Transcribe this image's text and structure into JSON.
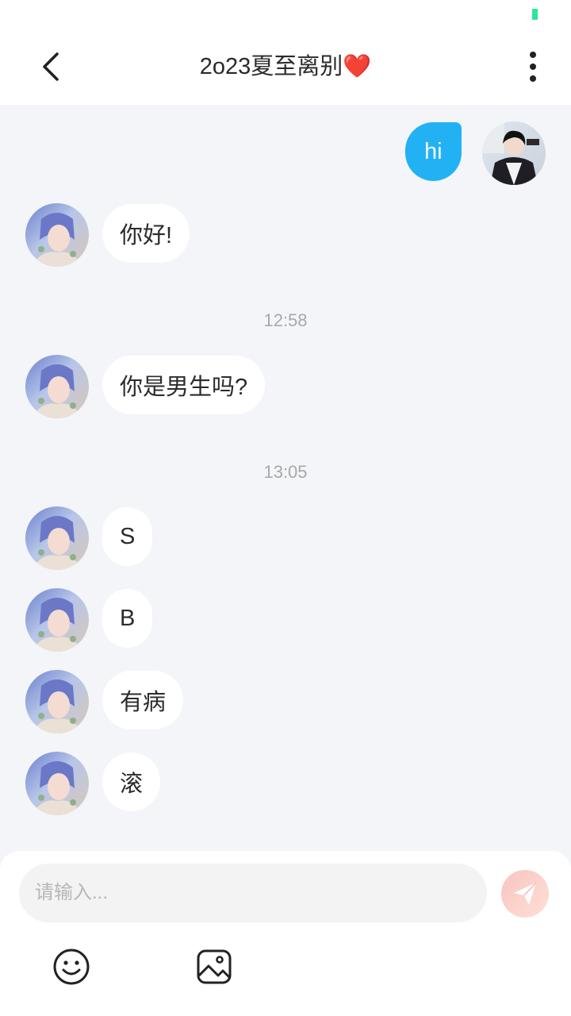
{
  "header": {
    "title": "2o23夏至离别❤️"
  },
  "messages": [
    {
      "side": "me",
      "text": "hi"
    },
    {
      "side": "other",
      "text": "你好!"
    },
    {
      "time": "12:58"
    },
    {
      "side": "other",
      "text": "你是男生吗?"
    },
    {
      "time": "13:05"
    },
    {
      "side": "other",
      "text": "S"
    },
    {
      "side": "other",
      "text": "B"
    },
    {
      "side": "other",
      "text": "有病"
    },
    {
      "side": "other",
      "text": "滚"
    }
  ],
  "composer": {
    "placeholder": "请输入..."
  },
  "icons": {
    "back": "chevron-left-icon",
    "more": "more-vertical-icon",
    "send": "paper-plane-icon",
    "emoji": "emoji-icon",
    "image": "image-icon"
  },
  "colors": {
    "my_bubble": "#22b2f4",
    "background": "#f3f5f8",
    "send_button": "#f9c4c1"
  }
}
